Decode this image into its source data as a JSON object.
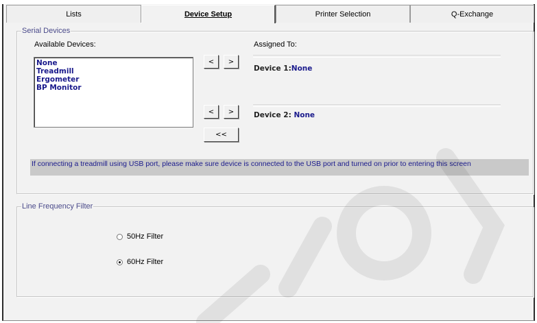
{
  "tabs": [
    {
      "label": "Lists",
      "active": false
    },
    {
      "label": "Device Setup",
      "active": true
    },
    {
      "label": "Printer Selection",
      "active": false
    },
    {
      "label": "Q-Exchange",
      "active": false
    }
  ],
  "serial": {
    "legend": "Serial Devices",
    "available_label": "Available Devices:",
    "assigned_label": "Assigned To:",
    "devices": [
      "None",
      "Treadmill",
      "Ergometer",
      "BP Monitor"
    ],
    "device1_label": "Device 1:",
    "device1_value": "None",
    "device2_label": "Device 2: ",
    "device2_value": "None",
    "btn_left": "<",
    "btn_right": ">",
    "btn_clear": "<<",
    "notice": "If connecting a treadmill using USB port, please make sure device is connected to the USB port and turned on prior to entering this screen"
  },
  "line_filter": {
    "legend": "Line Frequency Filter",
    "options": [
      {
        "label": "50Hz Filter",
        "selected": false
      },
      {
        "label": "60Hz Filter",
        "selected": true
      }
    ]
  },
  "colors": {
    "accent_text": "#1a1a8c",
    "legend_text": "#4a4a8a",
    "panel_bg": "#f2f2f2"
  }
}
